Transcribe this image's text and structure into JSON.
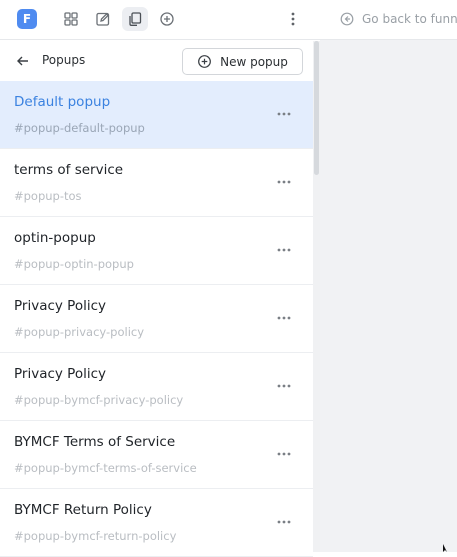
{
  "toolbar": {
    "logo_letter": "F",
    "brand_color": "#4f8bf0",
    "tools": [
      {
        "name": "grid-icon"
      },
      {
        "name": "edit-icon"
      },
      {
        "name": "copy-icon",
        "active": true
      },
      {
        "name": "add-circle-icon"
      }
    ],
    "more_icon": "vertical-dots-icon",
    "back_link": "Go back to funnel"
  },
  "panel": {
    "title": "Popups",
    "new_button_label": "New popup"
  },
  "popups": [
    {
      "name": "Default popup",
      "id": "#popup-default-popup",
      "selected": true
    },
    {
      "name": "terms of service",
      "id": "#popup-tos"
    },
    {
      "name": "optin-popup",
      "id": "#popup-optin-popup"
    },
    {
      "name": "Privacy Policy",
      "id": "#popup-privacy-policy"
    },
    {
      "name": "Privacy Policy",
      "id": "#popup-bymcf-privacy-policy"
    },
    {
      "name": "BYMCF Terms of Service",
      "id": "#popup-bymcf-terms-of-service"
    },
    {
      "name": "BYMCF Return Policy",
      "id": "#popup-bymcf-return-policy"
    }
  ],
  "colors": {
    "selected_bg": "#e3edfd",
    "selected_text": "#3b82e0",
    "canvas_bg": "#f1f2f4"
  }
}
